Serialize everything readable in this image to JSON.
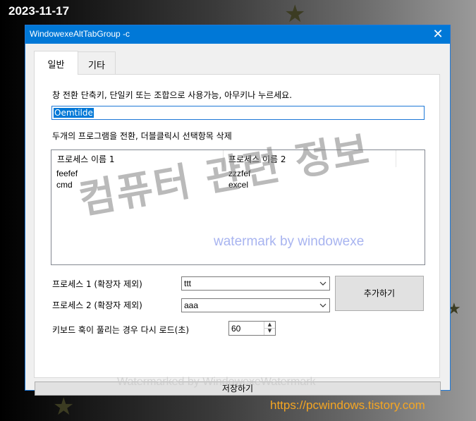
{
  "desktop": {
    "date": "2023-11-17",
    "url": "https://pcwindows.tistory.com"
  },
  "window": {
    "title": "WindowexeAltTabGroup -c",
    "close_icon": "close-icon"
  },
  "tabs": [
    {
      "label": "일반",
      "active": true
    },
    {
      "label": "기타",
      "active": false
    }
  ],
  "general": {
    "hotkey_instruction": "창 전환 단축키, 단일키 또는 조합으로 사용가능, 아무키나 누르세요.",
    "hotkey_value": "Oemtilde",
    "list_instruction": "두개의 프로그램을 전환, 더블클릭시 선택항목 삭제",
    "list": {
      "columns": [
        "프로세스 이름 1",
        "프로세스 이름 2"
      ],
      "rows": [
        [
          "feefef",
          "zzzfef"
        ],
        [
          "cmd",
          "excel"
        ]
      ]
    },
    "process1_label": "프로세스 1 (확장자 제외)",
    "process1_value": "ttt",
    "process2_label": "프로세스 2 (확장자 제외)",
    "process2_value": "aaa",
    "add_button": "추가하기",
    "reload_label": "키보드 훅이 풀리는 경우 다시 로드(초)",
    "reload_value": "60",
    "save_button": "저장하기"
  },
  "watermarks": {
    "korean": "컴퓨터 관련 정보",
    "blue": "watermark by windowexe",
    "bottom": "Watermarked by WindowexeWatermark"
  },
  "colors": {
    "accent": "#0078d7",
    "url": "#f5a623"
  }
}
